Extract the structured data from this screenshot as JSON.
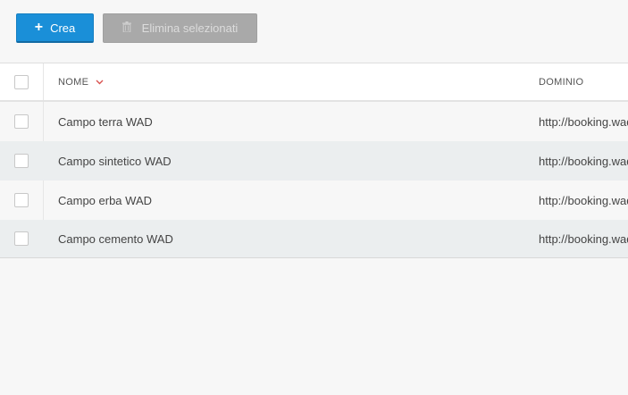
{
  "toolbar": {
    "create_label": "Crea",
    "create_icon": "plus-icon",
    "delete_label": "Elimina selezionati",
    "delete_icon": "trash-icon"
  },
  "table": {
    "columns": [
      {
        "label": "NOME",
        "sort": "descending",
        "sort_icon": "chevron-down-icon"
      },
      {
        "label": "DOMINIO"
      }
    ],
    "rows": [
      {
        "name": "Campo terra WAD",
        "domain": "http://booking.wad"
      },
      {
        "name": "Campo sintetico WAD",
        "domain": "http://booking.wad"
      },
      {
        "name": "Campo erba WAD",
        "domain": "http://booking.wad"
      },
      {
        "name": "Campo cemento WAD",
        "domain": "http://booking.wad"
      }
    ]
  },
  "colors": {
    "primary": "#1a8fd8",
    "disabled": "#a9a9a9",
    "sort_accent": "#d9534f",
    "row_alt": "#ebeeef"
  }
}
